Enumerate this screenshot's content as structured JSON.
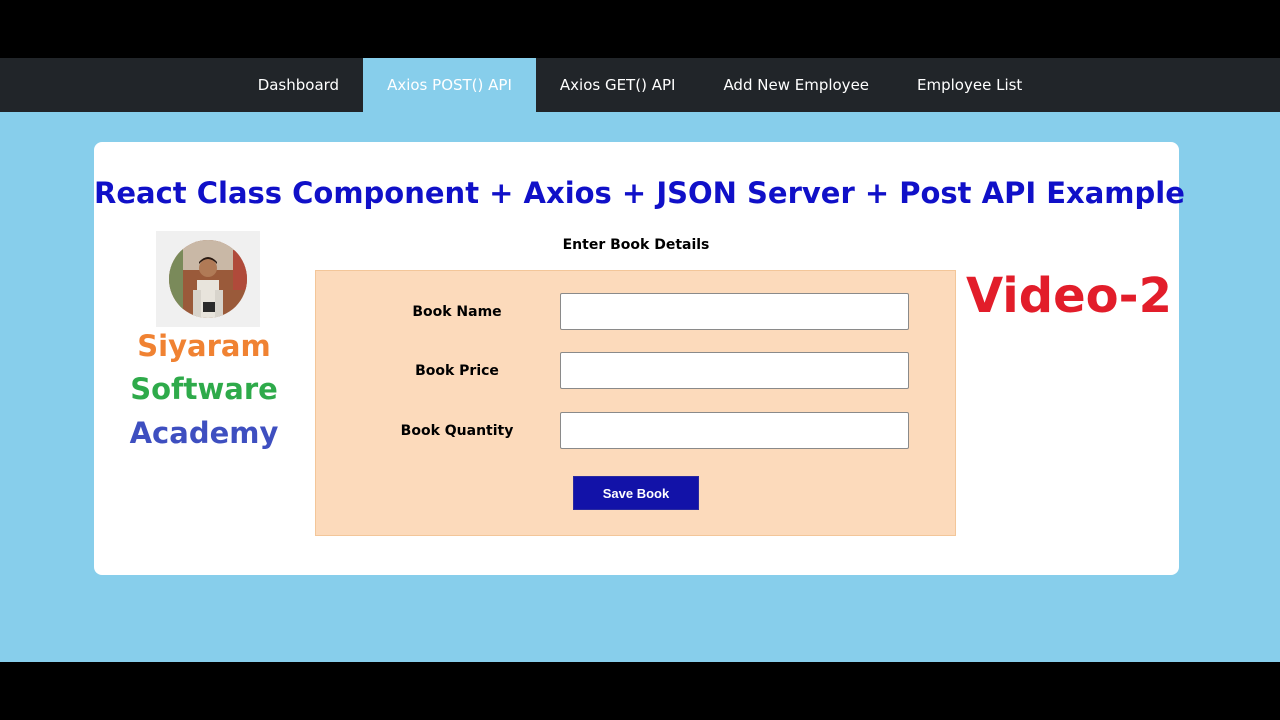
{
  "nav": {
    "items": [
      {
        "label": "Dashboard",
        "active": false
      },
      {
        "label": "Axios POST() API",
        "active": true
      },
      {
        "label": "Axios GET() API",
        "active": false
      },
      {
        "label": "Add New Employee",
        "active": false
      },
      {
        "label": "Employee List",
        "active": false
      }
    ]
  },
  "main": {
    "title": "React Class Component + Axios + JSON Server + Post API Example"
  },
  "brand": {
    "line1": "Siyaram",
    "line2": "Software",
    "line3": "Academy",
    "colors": {
      "line1": "#f08232",
      "line2": "#2eaa4a",
      "line3": "#3e4fc0"
    }
  },
  "form": {
    "heading": "Enter Book Details",
    "fields": [
      {
        "label": "Book Name",
        "value": "",
        "placeholder": ""
      },
      {
        "label": "Book Price",
        "value": "",
        "placeholder": ""
      },
      {
        "label": "Book Quantity",
        "value": "",
        "placeholder": ""
      }
    ],
    "submit_label": "Save Book"
  },
  "video_tag": "Video-2",
  "colors": {
    "navbar": "#212529",
    "page_background": "#87ceeb",
    "title": "#1010c8",
    "form_panel": "#fcdabb",
    "button": "#1212a8",
    "video_tag": "#e21d2a"
  },
  "icons": {
    "avatar": "user-photo-icon"
  }
}
